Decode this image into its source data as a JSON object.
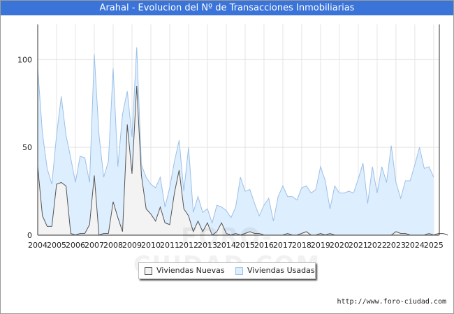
{
  "title": "Arahal - Evolucion del Nº de Transacciones Inmobiliarias",
  "watermark": "FORO-CIUDAD.COM",
  "url": "http://www.foro-ciudad.com",
  "colors": {
    "title_bg": "#3b74d9",
    "nuevas_fill": "#f3f3f3",
    "nuevas_line": "#555555",
    "usadas_fill": "#ddeeff",
    "usadas_line": "#9dc0e6"
  },
  "chart_data": {
    "type": "area",
    "title": "Arahal - Evolucion del Nº de Transacciones Inmobiliarias",
    "xlabel": "",
    "ylabel": "",
    "ylim": [
      0,
      120
    ],
    "xlim": [
      2004,
      2025.3
    ],
    "yticks": [
      0,
      50,
      100
    ],
    "grid": true,
    "legend_position": "bottom",
    "x_tick_labels": [
      "2004",
      "2005",
      "2006",
      "2007",
      "2008",
      "2009",
      "2010",
      "2011",
      "2012",
      "2013",
      "2014",
      "2015",
      "2016",
      "2017",
      "2018",
      "2019",
      "2020",
      "2021",
      "2022",
      "2023",
      "2024",
      "2025"
    ],
    "x_start": "2004 Q1",
    "x_step": "quarter",
    "series": [
      {
        "name": "Viviendas Nuevas",
        "values": [
          39,
          11,
          5,
          5,
          29,
          30,
          28,
          1,
          0,
          1,
          1,
          6,
          34,
          0,
          1,
          1,
          19,
          10,
          2,
          63,
          35,
          85,
          34,
          15,
          12,
          8,
          16,
          7,
          6,
          24,
          37,
          15,
          11,
          2,
          8,
          2,
          7,
          0,
          2,
          7,
          1,
          0,
          1,
          0,
          1,
          2,
          1,
          1,
          0,
          0,
          0,
          0,
          0,
          1,
          0,
          0,
          1,
          2,
          0,
          0,
          1,
          0,
          1,
          0,
          0,
          0,
          0,
          0,
          0,
          0,
          0,
          0,
          0,
          0,
          0,
          0,
          2,
          1,
          1,
          0,
          0,
          0,
          0,
          1,
          0,
          1,
          1,
          0
        ]
      },
      {
        "name": "Viviendas Usadas",
        "values": [
          95,
          58,
          38,
          29,
          57,
          79,
          57,
          44,
          30,
          45,
          44,
          30,
          103,
          57,
          33,
          42,
          95,
          39,
          69,
          82,
          56,
          107,
          40,
          33,
          29,
          27,
          33,
          16,
          27,
          42,
          54,
          25,
          50,
          13,
          22,
          13,
          15,
          7,
          17,
          16,
          14,
          10,
          16,
          33,
          25,
          26,
          18,
          11,
          17,
          21,
          8,
          22,
          28,
          22,
          22,
          20,
          27,
          28,
          24,
          26,
          39,
          31,
          15,
          28,
          24,
          24,
          25,
          24,
          32,
          41,
          18,
          39,
          24,
          39,
          30,
          51,
          30,
          21,
          31,
          31,
          40,
          50,
          38,
          39,
          33
        ]
      }
    ]
  }
}
